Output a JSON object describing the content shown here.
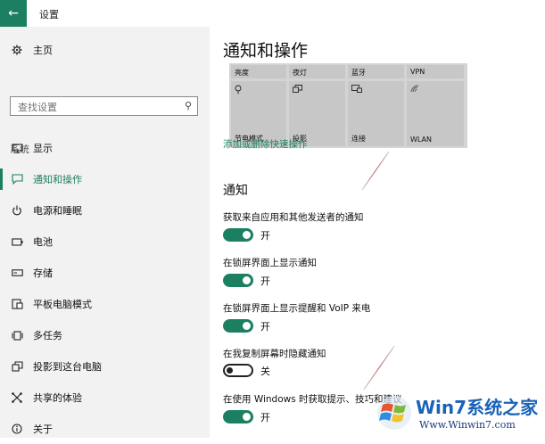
{
  "window": {
    "back_icon": "arrow-left-icon",
    "title": "设置"
  },
  "sidebar": {
    "home": {
      "label": "主页",
      "icon": "gear-icon"
    },
    "search": {
      "placeholder": "查找设置",
      "icon": "search-icon"
    },
    "section_label": "系统",
    "items": [
      {
        "label": "显示",
        "icon": "monitor-icon"
      },
      {
        "label": "通知和操作",
        "icon": "notification-icon",
        "active": true
      },
      {
        "label": "电源和睡眠",
        "icon": "power-icon"
      },
      {
        "label": "电池",
        "icon": "battery-icon"
      },
      {
        "label": "存储",
        "icon": "storage-icon"
      },
      {
        "label": "平板电脑模式",
        "icon": "tablet-mode-icon"
      },
      {
        "label": "多任务",
        "icon": "multitask-icon"
      },
      {
        "label": "投影到这台电脑",
        "icon": "project-icon"
      },
      {
        "label": "共享的体验",
        "icon": "shared-experience-icon"
      },
      {
        "label": "关于",
        "icon": "info-icon"
      }
    ],
    "accent": "#1d7f62"
  },
  "main": {
    "title": "通知和操作",
    "quick_actions": [
      {
        "label": "亮度"
      },
      {
        "label": "夜灯"
      },
      {
        "label": "蓝牙"
      },
      {
        "label": "VPN"
      },
      {
        "label": "节电模式",
        "icon": "battery-saver-icon"
      },
      {
        "label": "投影",
        "icon": "project-icon"
      },
      {
        "label": "连接",
        "icon": "connect-icon"
      },
      {
        "label": "WLAN",
        "icon": "wifi-icon"
      }
    ],
    "quick_actions_link": "添加或删除快速操作",
    "notifications_heading": "通知",
    "settings": [
      {
        "label": "获取来自应用和其他发送者的通知",
        "state": "开",
        "on": true
      },
      {
        "label": "在锁屏界面上显示通知",
        "state": "开",
        "on": true
      },
      {
        "label": "在锁屏界面上显示提醒和 VoIP 来电",
        "state": "开",
        "on": true
      },
      {
        "label": "在我复制屏幕时隐藏通知",
        "state": "关",
        "on": false
      },
      {
        "label": "在使用 Windows 时获取提示、技巧和建议",
        "state": "开",
        "on": true
      }
    ]
  },
  "watermark": {
    "title": "Win7系统之家",
    "url": "Www.Winwin7.com"
  }
}
